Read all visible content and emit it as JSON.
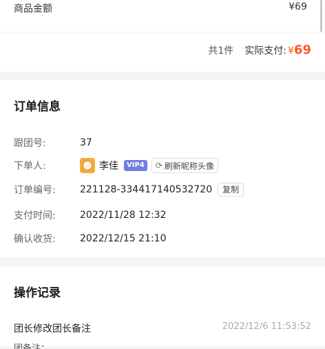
{
  "amount": {
    "label": "商品金额",
    "value": "¥69"
  },
  "summary": {
    "count_text": "共1件",
    "pay_label": "实际支付:",
    "pay_currency": "¥",
    "pay_amount": "69"
  },
  "order_info": {
    "title": "订单信息",
    "group_no": {
      "label": "跟团号:",
      "value": "37"
    },
    "orderer": {
      "label": "下单人:",
      "name": "李佳",
      "vip": "VIP4",
      "refresh_button": "刷新昵称头像"
    },
    "order_no": {
      "label": "订单编号:",
      "value": "221128-334417140532720",
      "copy_button": "复制"
    },
    "pay_time": {
      "label": "支付时间:",
      "value": "2022/11/28 12:32"
    },
    "confirm_time": {
      "label": "确认收货:",
      "value": "2022/12/15 21:10"
    }
  },
  "operations": {
    "title": "操作记录",
    "records": [
      {
        "title": "团长修改团长备注",
        "time": "2022/12/6 11:53:52",
        "note": "团备注：......"
      }
    ]
  },
  "colors": {
    "accent": "#ff5a1f",
    "vip": "#6f7fe0"
  },
  "icons": {
    "refresh": "refresh-icon",
    "avatar": "avatar-image"
  }
}
